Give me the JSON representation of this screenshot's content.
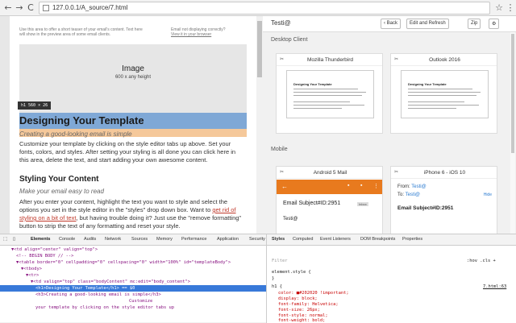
{
  "browser": {
    "url": "127.0.0.1/A_source/7.html",
    "back_glyph": "←",
    "forward_glyph": "→",
    "reload_glyph": "C",
    "star_glyph": "☆",
    "menu_glyph": "⋮"
  },
  "email": {
    "preheader_left": "Use this area to offer a short teaser of your email's content. Text here will show in the preview area of some email clients.",
    "preheader_right_1": "Email not displaying correctly?",
    "preheader_right_2": "View it in your browser",
    "image_title": "Image",
    "image_size": "600 x any height",
    "tooltip": "h1  560 × 26",
    "h1": "Designing Your Template",
    "subtitle": "Creating a good-looking email is simple",
    "para1": "Customize your template by clicking on the style editor tabs up above. Set your fonts, colors, and styles. After setting your styling is all done you can click here in this area, delete the text, and start adding your own awesome content.",
    "h2": "Styling Your Content",
    "subtitle2": "Make your email easy to read",
    "para2_a": "After you enter your content, highlight the text you want to style and select the options you set in the style editor in the \"styles\" drop down box. Want to ",
    "para2_link": "get rid of styling on a bit of text",
    "para2_b": ", but having trouble doing it? Just use the \"remove formatting\" button to strip the text of any formatting and reset your style."
  },
  "testi": {
    "logo": "Testi@",
    "back_btn": "‹ Back",
    "edit_btn": "Edit and Refresh",
    "zip_btn": "Zip",
    "gear": "⚙",
    "desktop_header": "Desktop Client",
    "mobile_header": "Mobile",
    "cards": {
      "thunderbird": "Mozilla Thunderbird",
      "outlook": "Outlook 2016",
      "android": "Android 5 Mail",
      "iphone": "iPhone 6 - iOS 10"
    },
    "thumb_title": "Designing Your Template",
    "android_subject": "Email Subject#ID:2951",
    "android_badge": "Inbox",
    "android_from": "Testi@",
    "iphone_from_label": "From:",
    "iphone_from": "Testi@",
    "iphone_to_label": "To:",
    "iphone_to": "Testi@",
    "iphone_hide": "Hide",
    "iphone_subject": "Email Subject#ID:2951"
  },
  "devtools": {
    "tabs": [
      "Elements",
      "Console",
      "Audits",
      "Network",
      "Sources",
      "Memory",
      "Performance",
      "Application",
      "Security"
    ],
    "dom_lines": [
      {
        "indent": 14,
        "html": "▼<td align=\"center\" valign=\"top\">"
      },
      {
        "indent": 20,
        "html": "<!-- BEGIN BODY // -->"
      },
      {
        "indent": 20,
        "html": "▼<table border=\"0\" cellpadding=\"0\" cellspacing=\"0\" width=\"100%\" id=\"templateBody\">"
      },
      {
        "indent": 26,
        "html": "▼<tbody>"
      },
      {
        "indent": 32,
        "html": "▼<tr>"
      },
      {
        "indent": 38,
        "html": "▼<td valign=\"top\" class=\"bodyContent\" mc:edit=\"body_content\">"
      },
      {
        "indent": 44,
        "html": "<h1>Designing Your Template</h1> == $0"
      },
      {
        "indent": 44,
        "html": "<h3>Creating a good-looking email is simple</h3>"
      },
      {
        "indent": 160,
        "html": "Customize"
      },
      {
        "indent": 44,
        "html": "your template by clicking on the style editor tabs up"
      }
    ],
    "styles_tabs": [
      "Styles",
      "Computed",
      "Event Listeners",
      "DOM Breakpoints",
      "Properties"
    ],
    "filter": "Filter",
    "hov": ":hov  .cls  +",
    "element_style": "element.style {",
    "close_brace": "}",
    "rule_selector": "h1 {",
    "rule_source": "7.html:63",
    "props": [
      "color: ■#202020 !important;",
      "display: block;",
      "font-family: Helvetica;",
      "font-size: 26px;",
      "font-style: normal;",
      "font-weight: bold;"
    ]
  }
}
